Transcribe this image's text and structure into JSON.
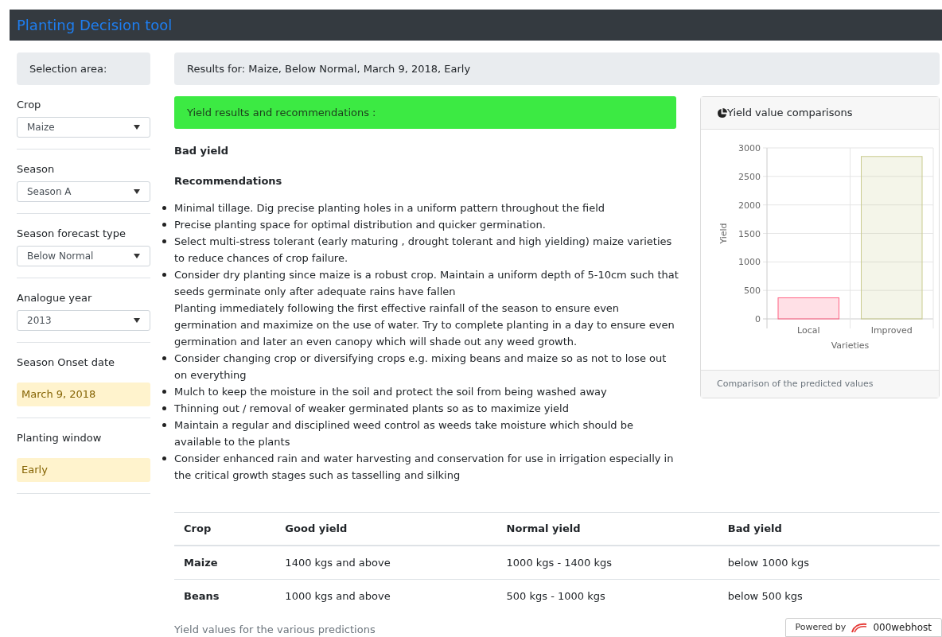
{
  "navbar": {
    "title": "Planting Decision tool"
  },
  "sidebar": {
    "heading": "Selection area:",
    "fields": [
      {
        "kind": "select",
        "label": "Crop",
        "value": "Maize"
      },
      {
        "kind": "select",
        "label": "Season",
        "value": "Season A"
      },
      {
        "kind": "select",
        "label": "Season forecast type",
        "value": "Below Normal"
      },
      {
        "kind": "select",
        "label": "Analogue year",
        "value": "2013"
      },
      {
        "kind": "readout",
        "label": "Season Onset date",
        "value": "March 9, 2018"
      },
      {
        "kind": "readout",
        "label": "Planting window",
        "value": "Early"
      }
    ]
  },
  "results_header": "Results for: Maize, Below Normal, March 9, 2018, Early",
  "recommendations": {
    "banner": "Yield results and recommendations :",
    "verdict": "Bad yield",
    "heading": "Recommendations",
    "items": [
      {
        "paragraphs": [
          "Minimal tillage. Dig precise planting holes in a uniform pattern throughout the field"
        ]
      },
      {
        "paragraphs": [
          "Precise planting space for optimal distribution and quicker germination."
        ]
      },
      {
        "paragraphs": [
          "Select multi-stress tolerant (early maturing , drought tolerant and high yielding) maize varieties to reduce chances of crop failure."
        ]
      },
      {
        "paragraphs": [
          "Consider dry planting since maize is a robust crop. Maintain a uniform depth of 5-10cm such that seeds germinate only after adequate rains have fallen",
          "Planting immediately following the first effective rainfall of the season to ensure even germination and maximize on the use of water. Try to complete planting in a day to ensure even germination and later an even canopy which will shade out any weed growth."
        ]
      },
      {
        "paragraphs": [
          "Consider changing crop or diversifying crops e.g. mixing beans and maize so as not to lose out on everything"
        ]
      },
      {
        "paragraphs": [
          "Mulch to keep the moisture in the soil and protect the soil from being washed away"
        ]
      },
      {
        "paragraphs": [
          "Thinning out / removal of weaker germinated plants so as to maximize yield"
        ]
      },
      {
        "paragraphs": [
          "Maintain a regular and disciplined weed control as weeds take moisture which should be available to the plants"
        ]
      },
      {
        "paragraphs": [
          "Consider enhanced rain and water harvesting and conservation for use in irrigation especially in the critical growth stages such as tasselling and silking"
        ]
      }
    ]
  },
  "chart_card": {
    "title": "Yield value comparisons",
    "footer": "Comparison of the predicted values",
    "chart_data": {
      "type": "bar",
      "xlabel": "Varieties",
      "ylabel": "Yield",
      "categories": [
        "Local",
        "Improved"
      ],
      "grid": true,
      "ylim": [
        0,
        3000
      ],
      "yticks": [
        0,
        500,
        1000,
        1500,
        2000,
        2500,
        3000
      ],
      "colors": [
        "#ff6384",
        "#c9cb8f"
      ],
      "series": [
        {
          "values": [
            370,
            2850
          ]
        }
      ]
    }
  },
  "yield_table": {
    "columns": [
      "Crop",
      "Good yield",
      "Normal yield",
      "Bad yield"
    ],
    "rows": [
      [
        "Maize",
        "1400 kgs and above",
        "1000 kgs - 1400 kgs",
        "below 1000 kgs"
      ],
      [
        "Beans",
        "1000 kgs and above",
        "500 kgs - 1000 kgs",
        "below 500 kgs"
      ]
    ],
    "caption": "Yield values for the various predictions"
  },
  "hosting_badge": {
    "prefix": "Powered by",
    "brand": "000webhost"
  }
}
